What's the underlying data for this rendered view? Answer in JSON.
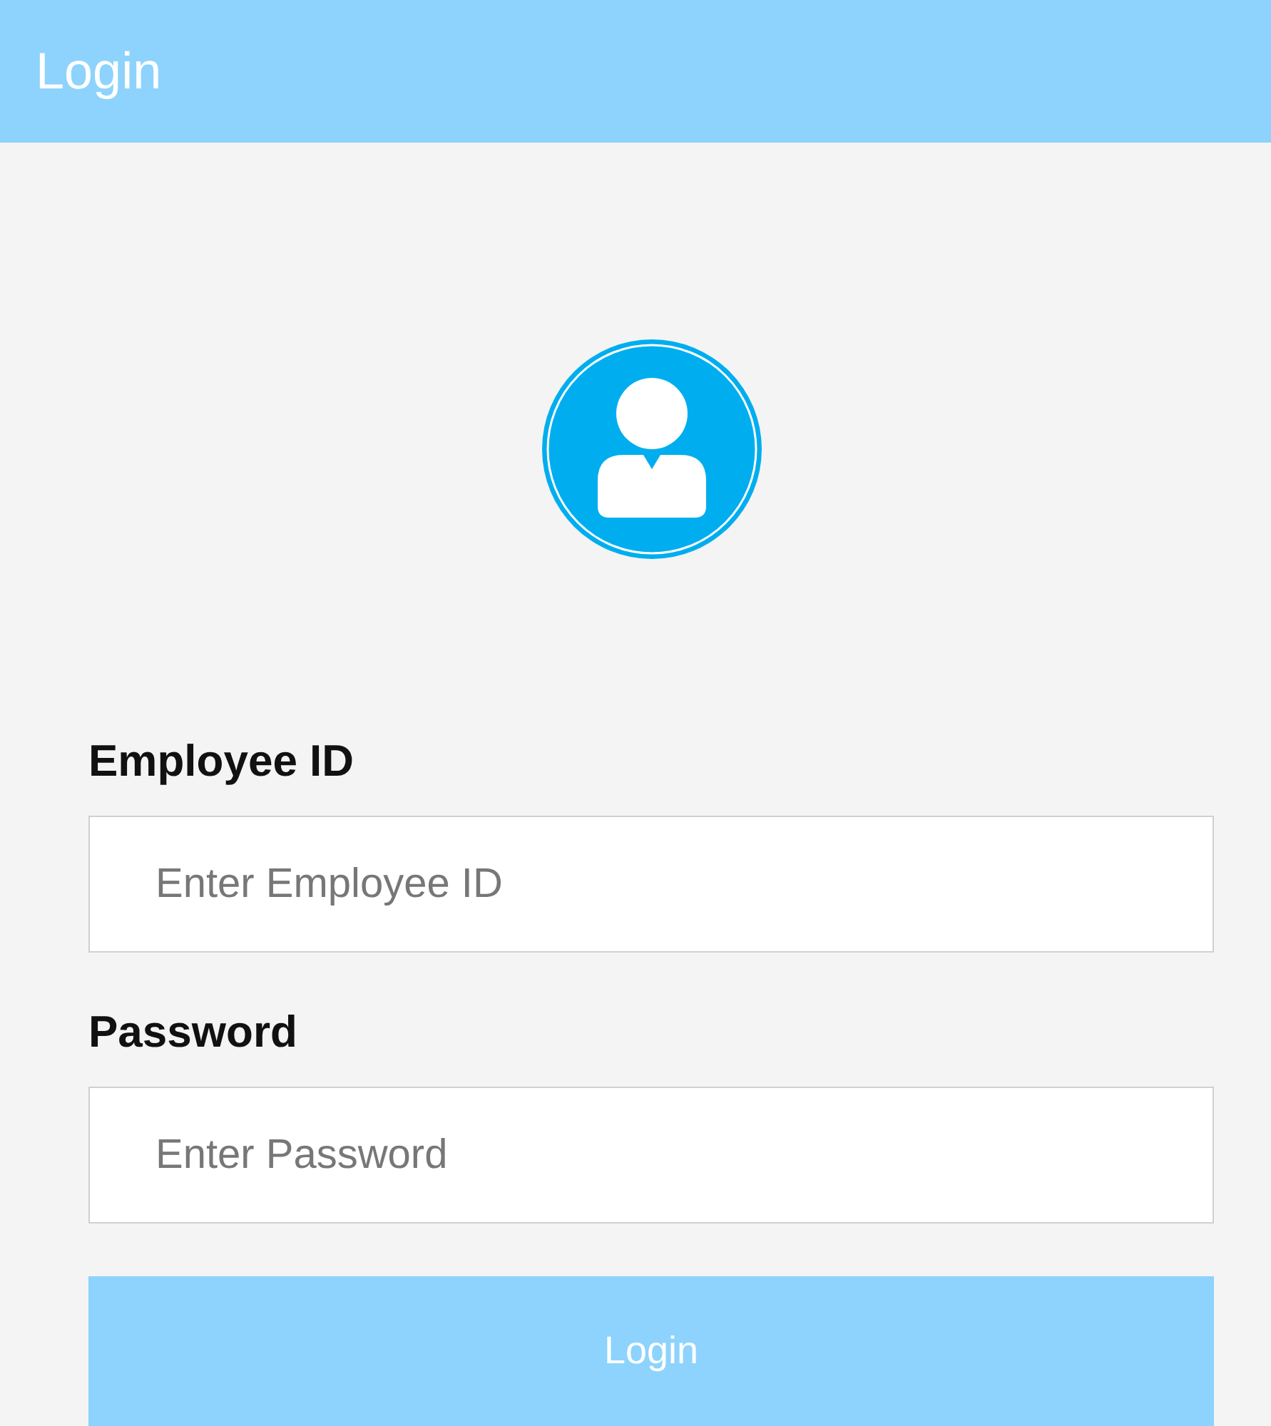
{
  "header": {
    "title": "Login"
  },
  "fields": [
    {
      "label": "Employee ID",
      "placeholder": "Enter Employee ID"
    },
    {
      "label": "Password",
      "placeholder": "Enter Password"
    }
  ],
  "button": {
    "label": "Login"
  }
}
